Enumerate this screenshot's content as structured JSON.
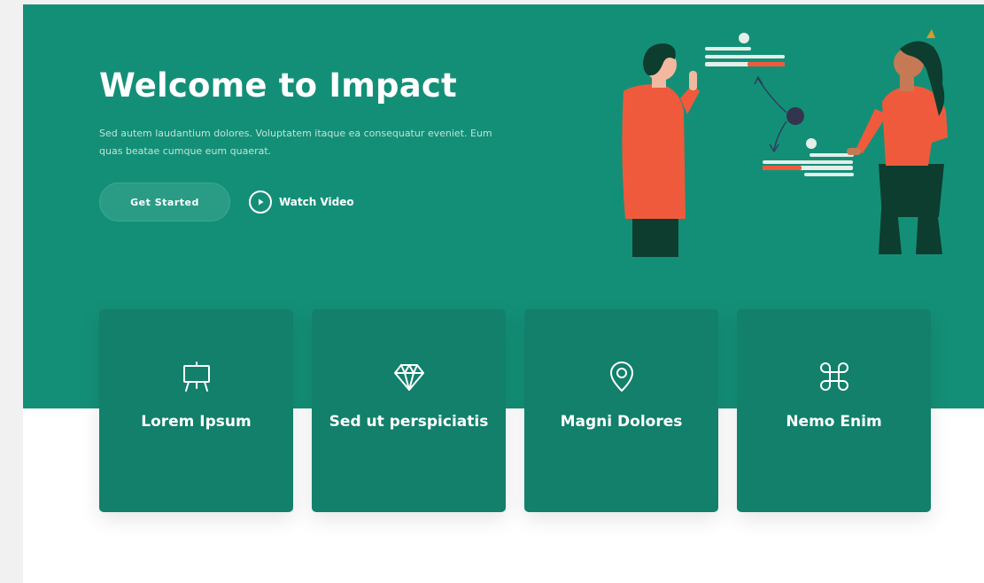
{
  "hero": {
    "title": "Welcome to Impact",
    "subtitle": "Sed autem laudantium dolores. Voluptatem itaque ea consequatur eveniet. Eum quas beatae cumque eum quaerat.",
    "get_started_label": "Get Started",
    "watch_video_label": "Watch Video"
  },
  "cards": [
    {
      "title": "Lorem Ipsum",
      "icon": "easel-icon"
    },
    {
      "title": "Sed ut perspiciatis",
      "icon": "gem-icon"
    },
    {
      "title": "Magni Dolores",
      "icon": "map-pin-icon"
    },
    {
      "title": "Nemo Enim",
      "icon": "command-icon"
    }
  ],
  "colors": {
    "hero_bg": "#148f77",
    "card_bg": "#12806b",
    "accent_orange": "#f05a3c",
    "dark_green": "#0c3d2e",
    "page_bg": "#ffffff"
  }
}
